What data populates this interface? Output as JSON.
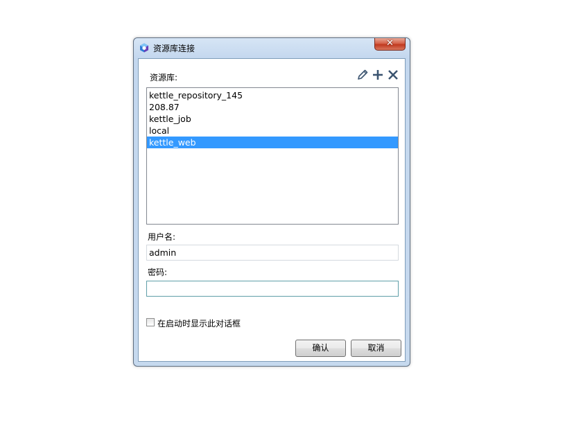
{
  "window": {
    "title": "资源库连接"
  },
  "repository": {
    "label": "资源库:",
    "items": [
      {
        "label": "kettle_repository_145",
        "selected": false
      },
      {
        "label": "208.87",
        "selected": false
      },
      {
        "label": "kettle_job",
        "selected": false
      },
      {
        "label": "local",
        "selected": false
      },
      {
        "label": "kettle_web",
        "selected": true
      }
    ],
    "toolbar": [
      "pencil-icon",
      "plus-icon",
      "close-icon"
    ]
  },
  "username": {
    "label": "用户名:",
    "value": "admin"
  },
  "password": {
    "label": "密码:",
    "value": ""
  },
  "startup_checkbox": {
    "label": "在启动时显示此对话框",
    "checked": false
  },
  "buttons": {
    "ok": "确认",
    "cancel": "取消"
  },
  "colors": {
    "selection": "#3399ff",
    "close_button": "#c0391f",
    "icon": "#3b5470"
  }
}
